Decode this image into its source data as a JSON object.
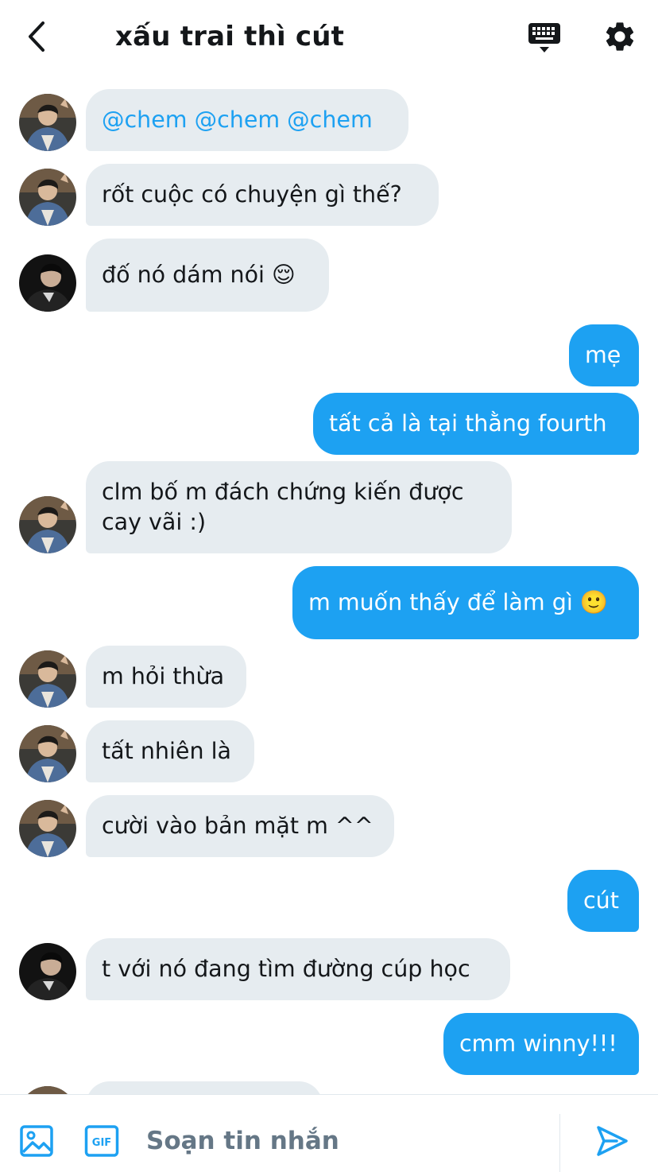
{
  "header": {
    "title": "xấu trai thì cút",
    "back_icon": "chevron-left-icon",
    "keyboard_icon": "keyboard-icon",
    "settings_icon": "gear-icon"
  },
  "colors": {
    "accent": "#1da1f2",
    "incoming_bubble": "#e6ecf0",
    "text_primary": "#14171a",
    "text_secondary": "#657786"
  },
  "messages": [
    {
      "side": "in",
      "avatar": "avatar-1",
      "text": "@chem @chem @chem",
      "mention": true
    },
    {
      "side": "in",
      "avatar": "avatar-1",
      "text": "rốt cuộc có chuyện gì thế?"
    },
    {
      "side": "in",
      "avatar": "avatar-2",
      "text": "đố nó dám nói 😌"
    },
    {
      "side": "out",
      "text": "mẹ"
    },
    {
      "side": "out",
      "text": "tất cả là tại thằng fourth"
    },
    {
      "side": "in",
      "avatar": "avatar-1",
      "text": "clm bố m đách chứng kiến được cay vãi :)"
    },
    {
      "side": "out",
      "text": "m muốn thấy để làm gì 🙂"
    },
    {
      "side": "in",
      "avatar": "avatar-1",
      "text": "m hỏi thừa"
    },
    {
      "side": "in",
      "avatar": "avatar-1",
      "text": "tất nhiên là"
    },
    {
      "side": "in",
      "avatar": "avatar-1",
      "text": "cười vào bản mặt m ^^"
    },
    {
      "side": "out",
      "text": "cút"
    },
    {
      "side": "in",
      "avatar": "avatar-2",
      "text": "t với nó đang tìm đường cúp học"
    },
    {
      "side": "out",
      "text": "cmm winny!!!"
    }
  ],
  "composer": {
    "placeholder": "Soạn tin nhắn",
    "media_icon": "image-icon",
    "gif_icon": "gif-icon",
    "gif_label": "GIF",
    "send_icon": "send-icon"
  }
}
